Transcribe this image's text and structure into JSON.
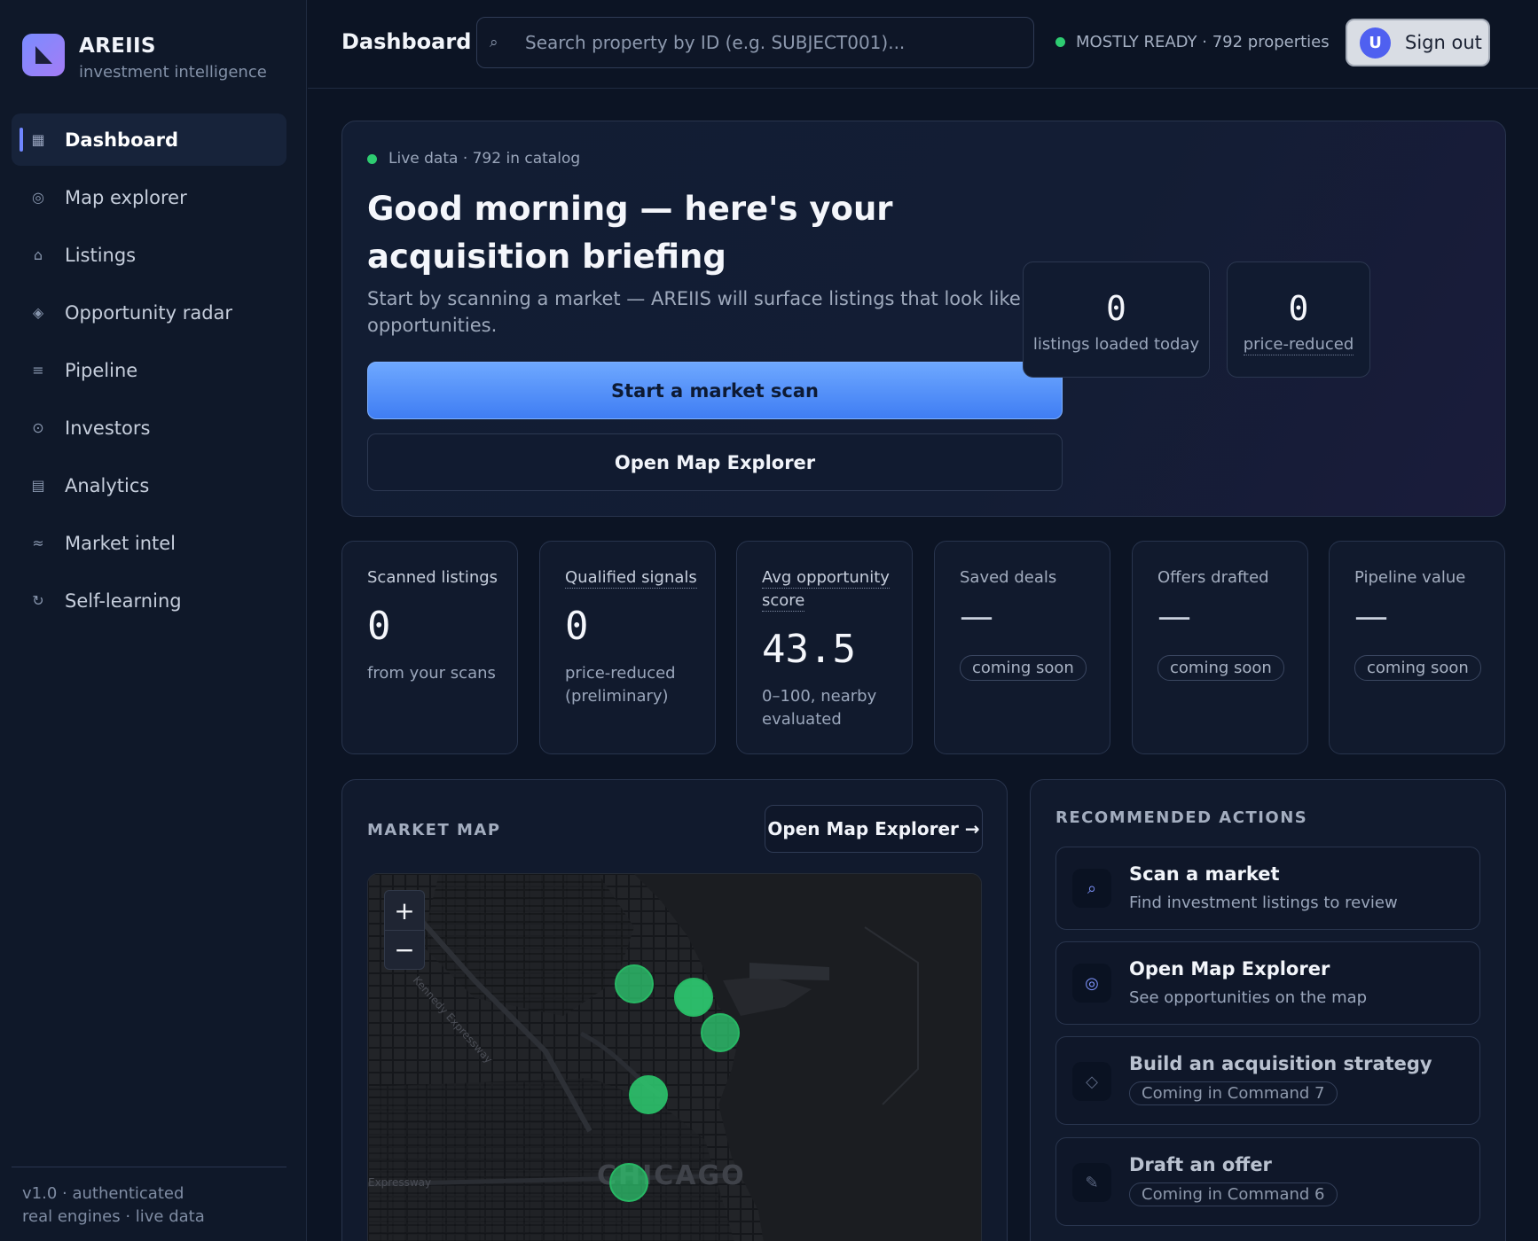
{
  "brand": {
    "name": "AREIIS",
    "tagline": "investment intelligence"
  },
  "nav": [
    {
      "label": "Dashboard",
      "icon": "grid-icon",
      "glyph": "▦",
      "active": true
    },
    {
      "label": "Map explorer",
      "icon": "map-icon",
      "glyph": "◎"
    },
    {
      "label": "Listings",
      "icon": "home-icon",
      "glyph": "⌂"
    },
    {
      "label": "Opportunity radar",
      "icon": "diamond-icon",
      "glyph": "◈"
    },
    {
      "label": "Pipeline",
      "icon": "pipeline-icon",
      "glyph": "≡"
    },
    {
      "label": "Investors",
      "icon": "investor-icon",
      "glyph": "⊙"
    },
    {
      "label": "Analytics",
      "icon": "analytics-icon",
      "glyph": "▤"
    },
    {
      "label": "Market intel",
      "icon": "wave-icon",
      "glyph": "≈"
    },
    {
      "label": "Self-learning",
      "icon": "refresh-icon",
      "glyph": "↻"
    }
  ],
  "footer": {
    "line1": "v1.0 · authenticated",
    "line2": "real engines · live data"
  },
  "header": {
    "title": "Dashboard",
    "search_placeholder": "Search property by ID (e.g. SUBJECT001)...",
    "status": "MOSTLY READY · 792 properties",
    "avatar_initial": "U",
    "signout": "Sign out"
  },
  "hero": {
    "live": "Live data · 792 in catalog",
    "title": "Good morning — here's your acquisition briefing",
    "subtitle": "Start by scanning a market — AREIIS will surface listings that look like opportunities.",
    "primary_btn": "Start a market scan",
    "secondary_btn": "Open Map Explorer",
    "stats": [
      {
        "value": "0",
        "label": "listings loaded today"
      },
      {
        "value": "0",
        "label": "price-reduced"
      }
    ]
  },
  "kpis": [
    {
      "label": "Scanned listings",
      "value": "0",
      "sub": "from your scans"
    },
    {
      "label": "Qualified signals",
      "value": "0",
      "sub": "price-reduced (preliminary)"
    },
    {
      "label": "Avg opportunity score",
      "value": "43.5",
      "sub": "0–100, nearby evaluated"
    },
    {
      "label": "Saved deals",
      "value": "—",
      "sub": "coming soon"
    },
    {
      "label": "Offers drafted",
      "value": "—",
      "sub": "coming soon"
    },
    {
      "label": "Pipeline value",
      "value": "—",
      "sub": "coming soon"
    }
  ],
  "map": {
    "heading": "MARKET MAP",
    "button": "Open Map Explorer →",
    "zoom_in": "+",
    "zoom_out": "−",
    "labels": {
      "city": "CHICAGO",
      "road1": "Kennedy Expressway",
      "road2": "Expressway"
    }
  },
  "actions": {
    "heading": "RECOMMENDED ACTIONS",
    "items": [
      {
        "title": "Scan a market",
        "sub": "Find investment listings to review",
        "icon": "search-icon"
      },
      {
        "title": "Open Map Explorer",
        "sub": "See opportunities on the map",
        "icon": "map-icon"
      },
      {
        "title": "Build an acquisition strategy",
        "sub": "Coming in Command 7",
        "icon": "diamond-icon"
      },
      {
        "title": "Draft an offer",
        "sub": "Coming in Command 6",
        "icon": "pencil-icon"
      }
    ]
  },
  "colors": {
    "accent": "#4f86f7",
    "live": "#2ecc71",
    "background": "#0c1424",
    "marker": "#2ecc71"
  }
}
